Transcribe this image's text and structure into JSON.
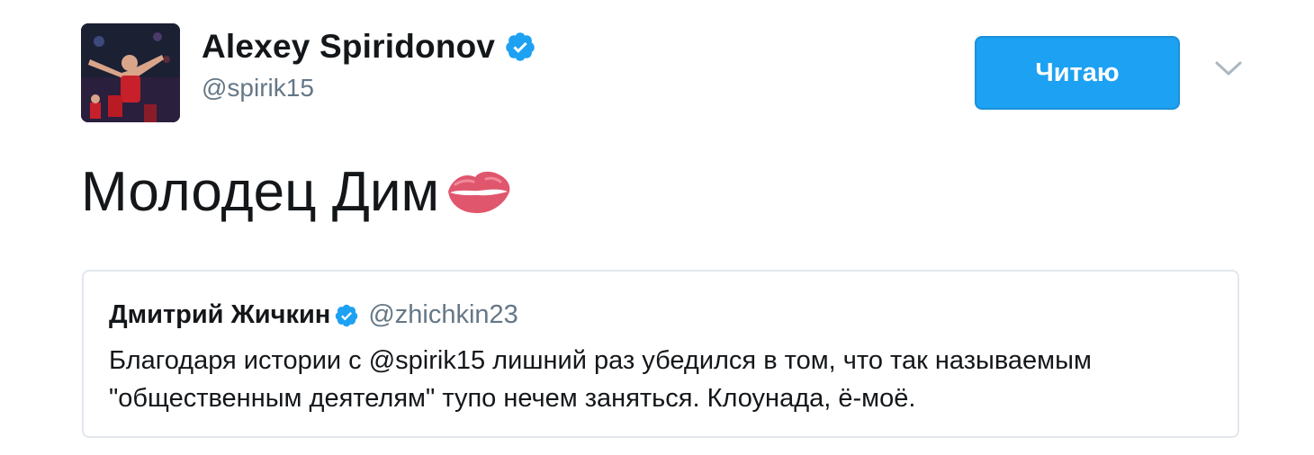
{
  "author": {
    "display_name": "Alexey Spiridonov",
    "handle": "@spirik15",
    "verified": true,
    "avatar": "avatar-photo"
  },
  "follow_button": {
    "label": "Читаю",
    "color": "#1da1f2"
  },
  "menu": {
    "icon": "chevron-down-icon"
  },
  "tweet": {
    "text": "Молодец Дим",
    "emoji": "kiss-mark-icon"
  },
  "quote": {
    "author_name": "Дмитрий Жичкин",
    "author_handle": "@zhichkin23",
    "verified": true,
    "text": "Благодаря истории с @spirik15 лишний раз убедился в том, что так называемым \"общественным деятелям\" тупо нечем заняться. Клоунада, ё-моё."
  },
  "colors": {
    "accent": "#1da1f2",
    "text": "#14171a",
    "secondary_text": "#657786",
    "border": "#e1e8ed",
    "verified": "#1da1f2"
  }
}
